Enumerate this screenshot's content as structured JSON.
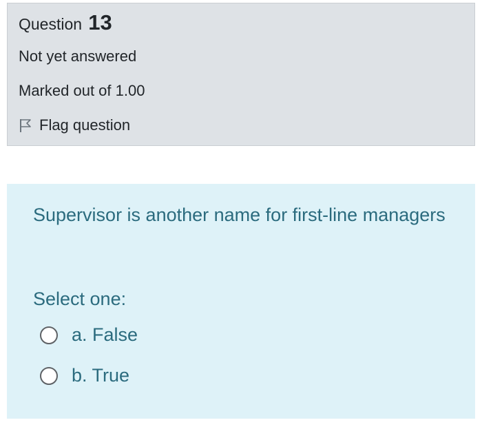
{
  "question": {
    "label": "Question",
    "number": "13",
    "state": "Not yet answered",
    "grade": "Marked out of 1.00",
    "flag_label": "Flag question",
    "flag_icon": "flag-outline-icon"
  },
  "content": {
    "text": "Supervisor is another name for first-line managers",
    "prompt": "Select one:",
    "options": [
      {
        "label": "a. False",
        "selected": false
      },
      {
        "label": "b. True",
        "selected": false
      }
    ]
  },
  "colors": {
    "info_bg": "#dee2e6",
    "content_bg": "#def2f8",
    "content_text": "#2b6b7e"
  }
}
